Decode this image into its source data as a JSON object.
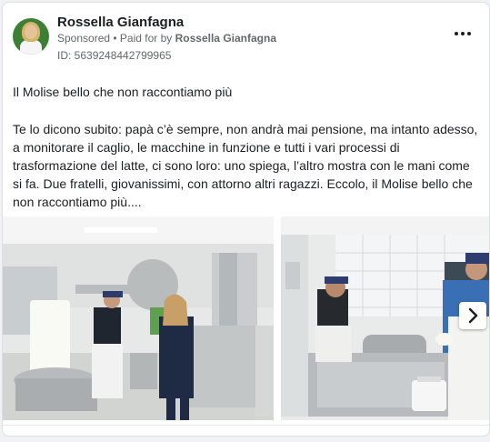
{
  "ad": {
    "advertiser_name": "Rossella Gianfagna",
    "sponsored_label": "Sponsored",
    "paid_for_prefix": " • Paid for by ",
    "paid_for_name": "Rossella Gianfagna",
    "library_id": "ID: 5639248442799965",
    "headline": "Il Molise bello che non raccontiamo più",
    "body": "Te lo dicono subito: papà c’è sempre, non andrà mai pensione, ma intanto adesso, a monitorare il caglio, le macchine in funzione e tutti i vari processi di trasformazione del latte, ci sono loro: uno spiega, l’altro mostra con le mani come si fa. Due fratelli, giovanissimi, con attorno altri ragazzi. Eccolo, il Molise bello che non raccontiamo più...."
  },
  "icons": {
    "more": "more-options-icon",
    "next": "chevron-right-icon"
  },
  "colors": {
    "page_bg": "#f0f2f5",
    "card_bg": "#ffffff",
    "text_primary": "#1c1e21",
    "text_secondary": "#65676b"
  }
}
